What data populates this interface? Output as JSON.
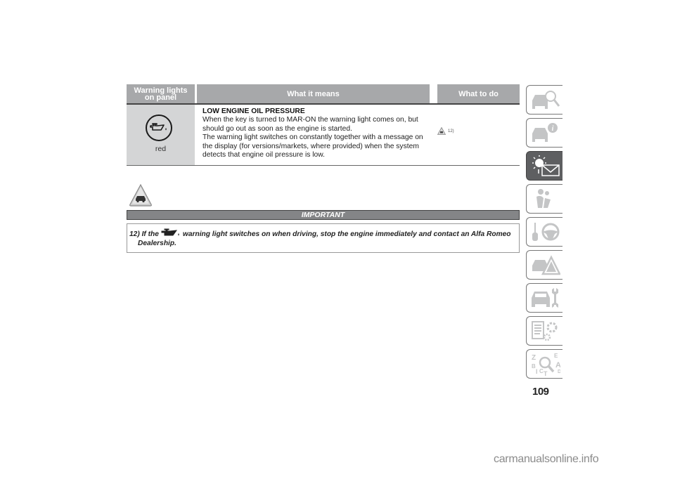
{
  "table": {
    "headers": {
      "col1": "Warning lights on panel",
      "col2": "What it means",
      "col3": "What to do"
    },
    "rows": [
      {
        "icon": "oil-can-icon",
        "color_label": "red",
        "title": "LOW ENGINE OIL PRESSURE",
        "paragraphs": [
          "When the key is turned to MAR-ON the warning light comes on, but should go out as soon as the engine is started.",
          "The warning light switches on constantly together with a message on the display (for versions/markets, where provided) when the system detects that engine oil pressure is low."
        ],
        "what_to_do": {
          "icon": "caution-triangle-icon",
          "reference": "12)"
        }
      }
    ]
  },
  "important": {
    "icon": "caution-triangle-car-icon",
    "heading": "IMPORTANT",
    "note_number": "12)",
    "text_before_icon": "If the",
    "inline_icon": "oil-can-icon",
    "text_after_icon": "warning light switches on when driving, stop the engine immediately and contact an Alfa Romeo",
    "text_continued": "Dealership."
  },
  "side_nav": {
    "tabs": [
      {
        "name": "knowing-the-car",
        "icon": "car-magnifier-icon",
        "active": false
      },
      {
        "name": "safety-info",
        "icon": "car-info-icon",
        "active": false
      },
      {
        "name": "warning-lights-messages",
        "icon": "light-envelope-icon",
        "active": true
      },
      {
        "name": "safety",
        "icon": "airbag-person-icon",
        "active": false
      },
      {
        "name": "starting-driving",
        "icon": "key-steering-wheel-icon",
        "active": false
      },
      {
        "name": "in-an-emergency",
        "icon": "car-warning-triangle-icon",
        "active": false
      },
      {
        "name": "servicing-care",
        "icon": "car-wrench-icon",
        "active": false
      },
      {
        "name": "technical-specifications",
        "icon": "list-gears-icon",
        "active": false
      },
      {
        "name": "index",
        "icon": "alphabet-magnifier-icon",
        "active": false
      }
    ]
  },
  "page_number": "109",
  "watermark": "carmanualsonline.info",
  "colors": {
    "header_bg": "#a7a8aa",
    "icon_cell_bg": "#d4d5d6",
    "important_bar_bg": "#848587",
    "active_tab_bg": "#5e5f61",
    "tab_icon": "#c4c5c6"
  }
}
